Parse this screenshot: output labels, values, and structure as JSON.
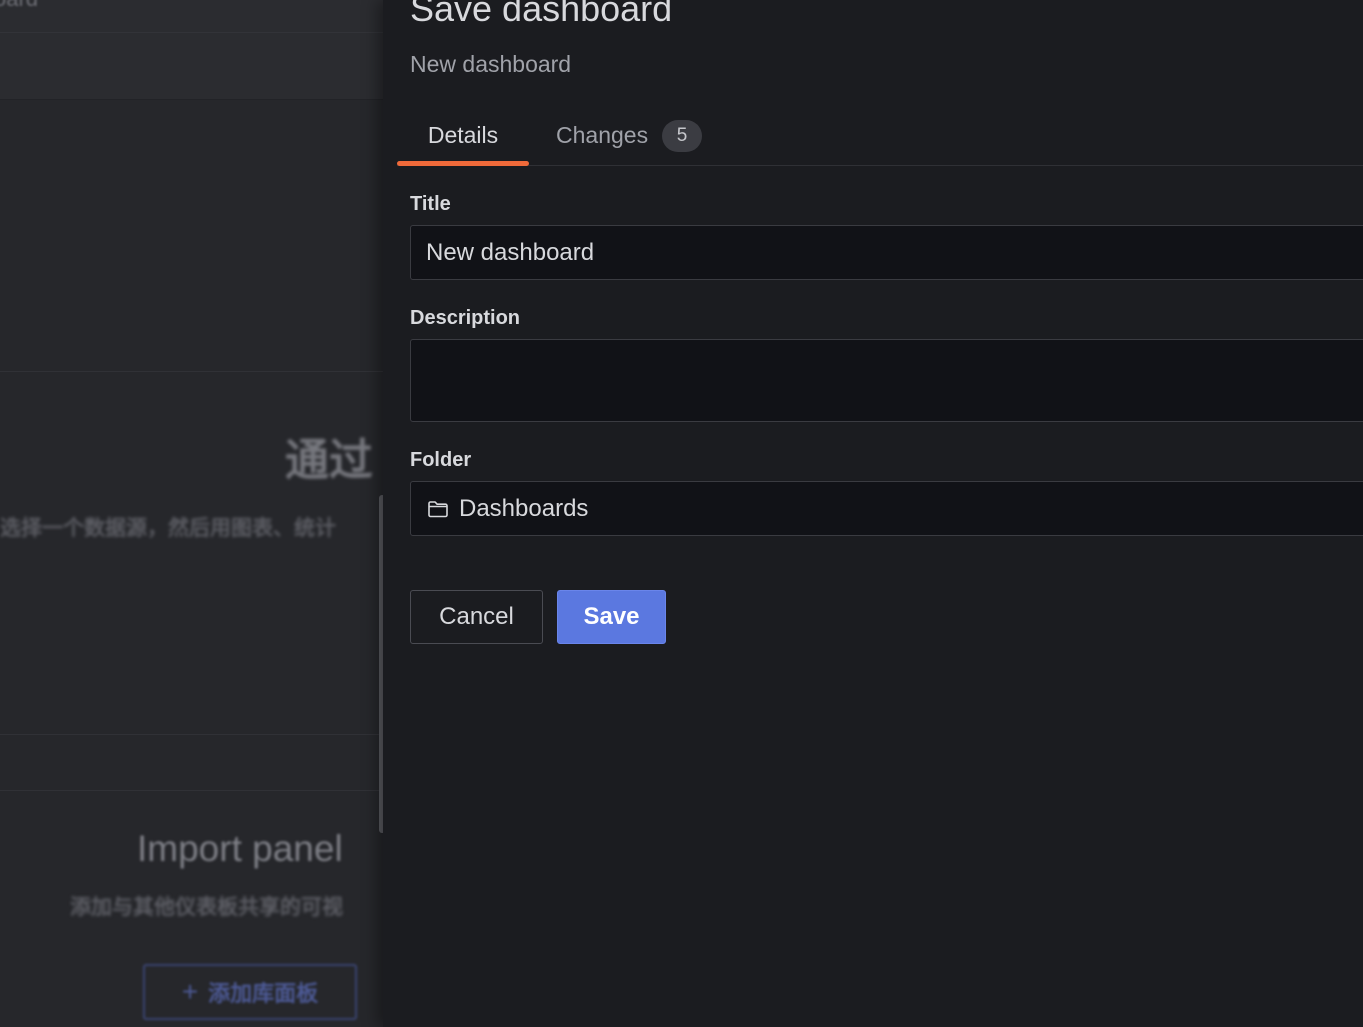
{
  "background": {
    "breadcrumb_fragment": "oard",
    "empty_heading": "通过",
    "empty_subtext": "选择一个数据源，然后用图表、统计",
    "import_title": "Import panel",
    "import_subtext": "添加与其他仪表板共享的可视",
    "add_library_panel_label": "添加库面板"
  },
  "drawer": {
    "title": "Save dashboard",
    "subtitle": "New dashboard",
    "tabs": [
      {
        "label": "Details",
        "active": true
      },
      {
        "label": "Changes",
        "badge": "5",
        "active": false
      }
    ],
    "form": {
      "title_label": "Title",
      "title_value": "New dashboard",
      "description_label": "Description",
      "description_value": "",
      "folder_label": "Folder",
      "folder_value": "Dashboards",
      "folder_icon": "folder-icon"
    },
    "buttons": {
      "cancel_label": "Cancel",
      "save_label": "Save"
    }
  },
  "colors": {
    "accent_tab_underline": "#f06a3a",
    "primary_button": "#5b78e0",
    "drawer_background": "#1b1c20",
    "input_background": "#111217"
  }
}
